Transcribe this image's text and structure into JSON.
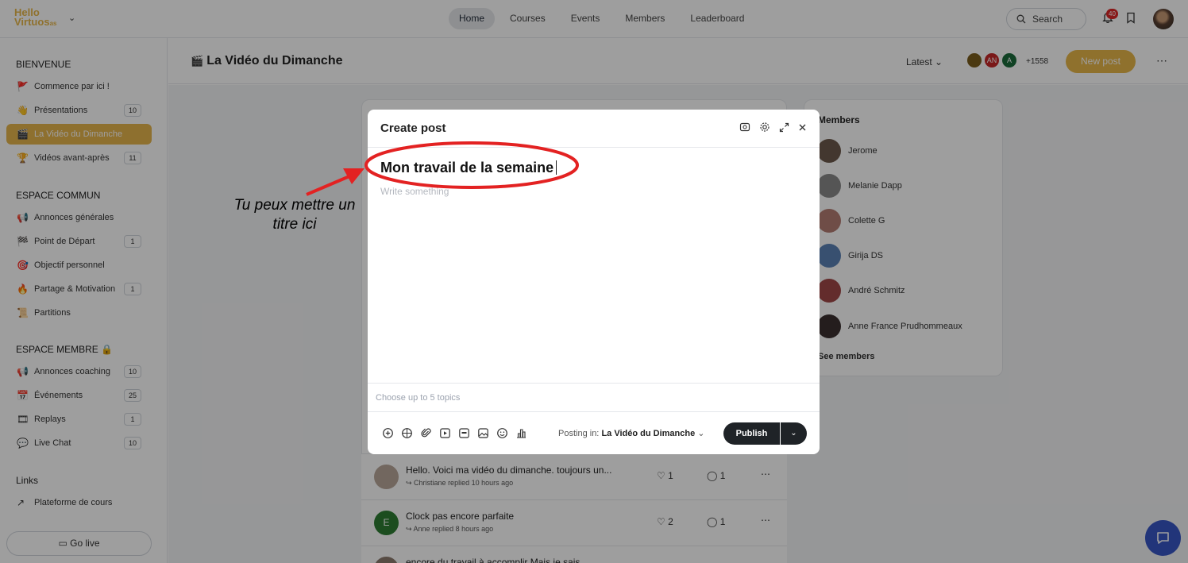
{
  "brand": {
    "logo_line1": "Hello",
    "logo_line2": "Virtuos",
    "logo_suffix": "as",
    "accent_color": "#e7b64a"
  },
  "topnav": {
    "items": [
      "Home",
      "Courses",
      "Events",
      "Members",
      "Leaderboard"
    ],
    "active": "Home",
    "search_label": "Search",
    "notification_count": "40"
  },
  "sidebar": {
    "sections": [
      {
        "title": "BIENVENUE",
        "items": [
          {
            "emoji": "🚩",
            "label": "Commence par ici !",
            "count": ""
          },
          {
            "emoji": "👋",
            "label": "Présentations",
            "count": "10"
          },
          {
            "emoji": "🎬",
            "label": "La Vidéo du Dimanche",
            "count": "",
            "active": true
          },
          {
            "emoji": "🏆",
            "label": "Vidéos avant-après",
            "count": "11"
          }
        ]
      },
      {
        "title": "ESPACE COMMUN",
        "items": [
          {
            "emoji": "📢",
            "label": "Annonces générales",
            "count": ""
          },
          {
            "emoji": "🏁",
            "label": "Point de Départ",
            "count": "1"
          },
          {
            "emoji": "🎯",
            "label": "Objectif personnel",
            "count": ""
          },
          {
            "emoji": "🔥",
            "label": "Partage & Motivation",
            "count": "1"
          },
          {
            "emoji": "📜",
            "label": "Partitions",
            "count": ""
          }
        ]
      },
      {
        "title": "ESPACE MEMBRE 🔒",
        "items": [
          {
            "emoji": "📢",
            "label": "Annonces coaching",
            "count": "10"
          },
          {
            "emoji": "📅",
            "label": "Événements",
            "count": "25"
          },
          {
            "emoji": "🎞",
            "label": "Replays",
            "count": "1"
          },
          {
            "emoji": "💬",
            "label": "Live Chat",
            "count": "10"
          }
        ]
      },
      {
        "title": "Links",
        "items": [
          {
            "emoji": "↗",
            "label": "Plateforme de cours",
            "count": ""
          }
        ]
      }
    ],
    "go_live_label": "Go live"
  },
  "space": {
    "emoji": "🎬",
    "title": "La Vidéo du Dimanche",
    "sort_label": "Latest",
    "avatars": [
      {
        "initials": "",
        "color": "#7a5c1c"
      },
      {
        "initials": "AN",
        "color": "#c62828"
      },
      {
        "initials": "A",
        "color": "#1b6b3a"
      }
    ],
    "extra_members": "+1558",
    "new_post_label": "New post"
  },
  "posts": [
    {
      "title": "Hello.  Voici ma vidéo  du dimanche. toujours un...",
      "reply": "Christiane replied 10 hours ago",
      "likes": "1",
      "comments": "1",
      "avatar_initial": "",
      "avatar_color": "#b9a79a"
    },
    {
      "title": "Clock pas encore parfaite",
      "reply": "Anne replied 8 hours ago",
      "likes": "2",
      "comments": "1",
      "avatar_initial": "E",
      "avatar_color": "#2e7d32"
    },
    {
      "title": "encore du travail à accomplir Mais je sais",
      "reply": "",
      "likes": "",
      "comments": "",
      "avatar_initial": "",
      "avatar_color": "#8d7b6f"
    }
  ],
  "members_widget": {
    "title": "Members",
    "members": [
      {
        "name": "Jerome",
        "color": "#6d5a4c"
      },
      {
        "name": "Melanie Dapp",
        "color": "#8a8a8a"
      },
      {
        "name": "Colette G",
        "color": "#b47c73"
      },
      {
        "name": "Girija DS",
        "color": "#5b82b5"
      },
      {
        "name": "André Schmitz",
        "color": "#a04848"
      },
      {
        "name": "Anne France Prudhommeaux",
        "color": "#3b3030"
      }
    ],
    "see_members_label": "See members"
  },
  "modal": {
    "title": "Create post",
    "post_title": "Mon travail de la semaine",
    "body_placeholder": "Write something",
    "topics_placeholder": "Choose up to 5 topics",
    "posting_in_label": "Posting in:",
    "posting_in_space": "La Vidéo du Dimanche",
    "publish_label": "Publish",
    "toolbar_icons": [
      "plus-circle-icon",
      "embed-icon",
      "attachment-icon",
      "video-icon",
      "gif-icon",
      "image-icon",
      "emoji-icon",
      "poll-icon"
    ]
  },
  "annotation": {
    "text_line1": "Tu peux mettre un",
    "text_line2": "titre ici",
    "color": "#e32222"
  }
}
